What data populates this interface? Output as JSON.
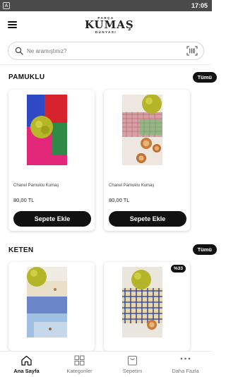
{
  "status_bar": {
    "left_icon": "A",
    "time": "17:05"
  },
  "header": {
    "logo_top": "PARÇA",
    "logo_main": "KUMAŞ",
    "logo_bottom": "DÜNYASI"
  },
  "search": {
    "placeholder": "Ne aramıştınız?"
  },
  "sections": [
    {
      "title": "PAMUKLU",
      "all_label": "Tümü",
      "products": [
        {
          "name": "Chanel Pamuklu Kumaş",
          "price": "80,00 TL",
          "button": "Sepete Ekle"
        },
        {
          "name": "Chanel Pamuklu Kumaş",
          "price": "80,00 TL",
          "button": "Sepete Ekle"
        }
      ]
    },
    {
      "title": "KETEN",
      "all_label": "Tümü",
      "products": [
        {
          "badge": ""
        },
        {
          "badge": "%33"
        }
      ]
    }
  ],
  "tabs": [
    {
      "label": "Ana Sayfa",
      "icon": "home-icon",
      "active": true
    },
    {
      "label": "Kategoriler",
      "icon": "grid-icon",
      "active": false
    },
    {
      "label": "Sepetim",
      "icon": "bag-icon",
      "active": false
    },
    {
      "label": "Daha Fazla",
      "icon": "more-icon",
      "active": false
    }
  ],
  "colors": {
    "primary": "#111111",
    "status_bar": "#4a4a4a"
  }
}
